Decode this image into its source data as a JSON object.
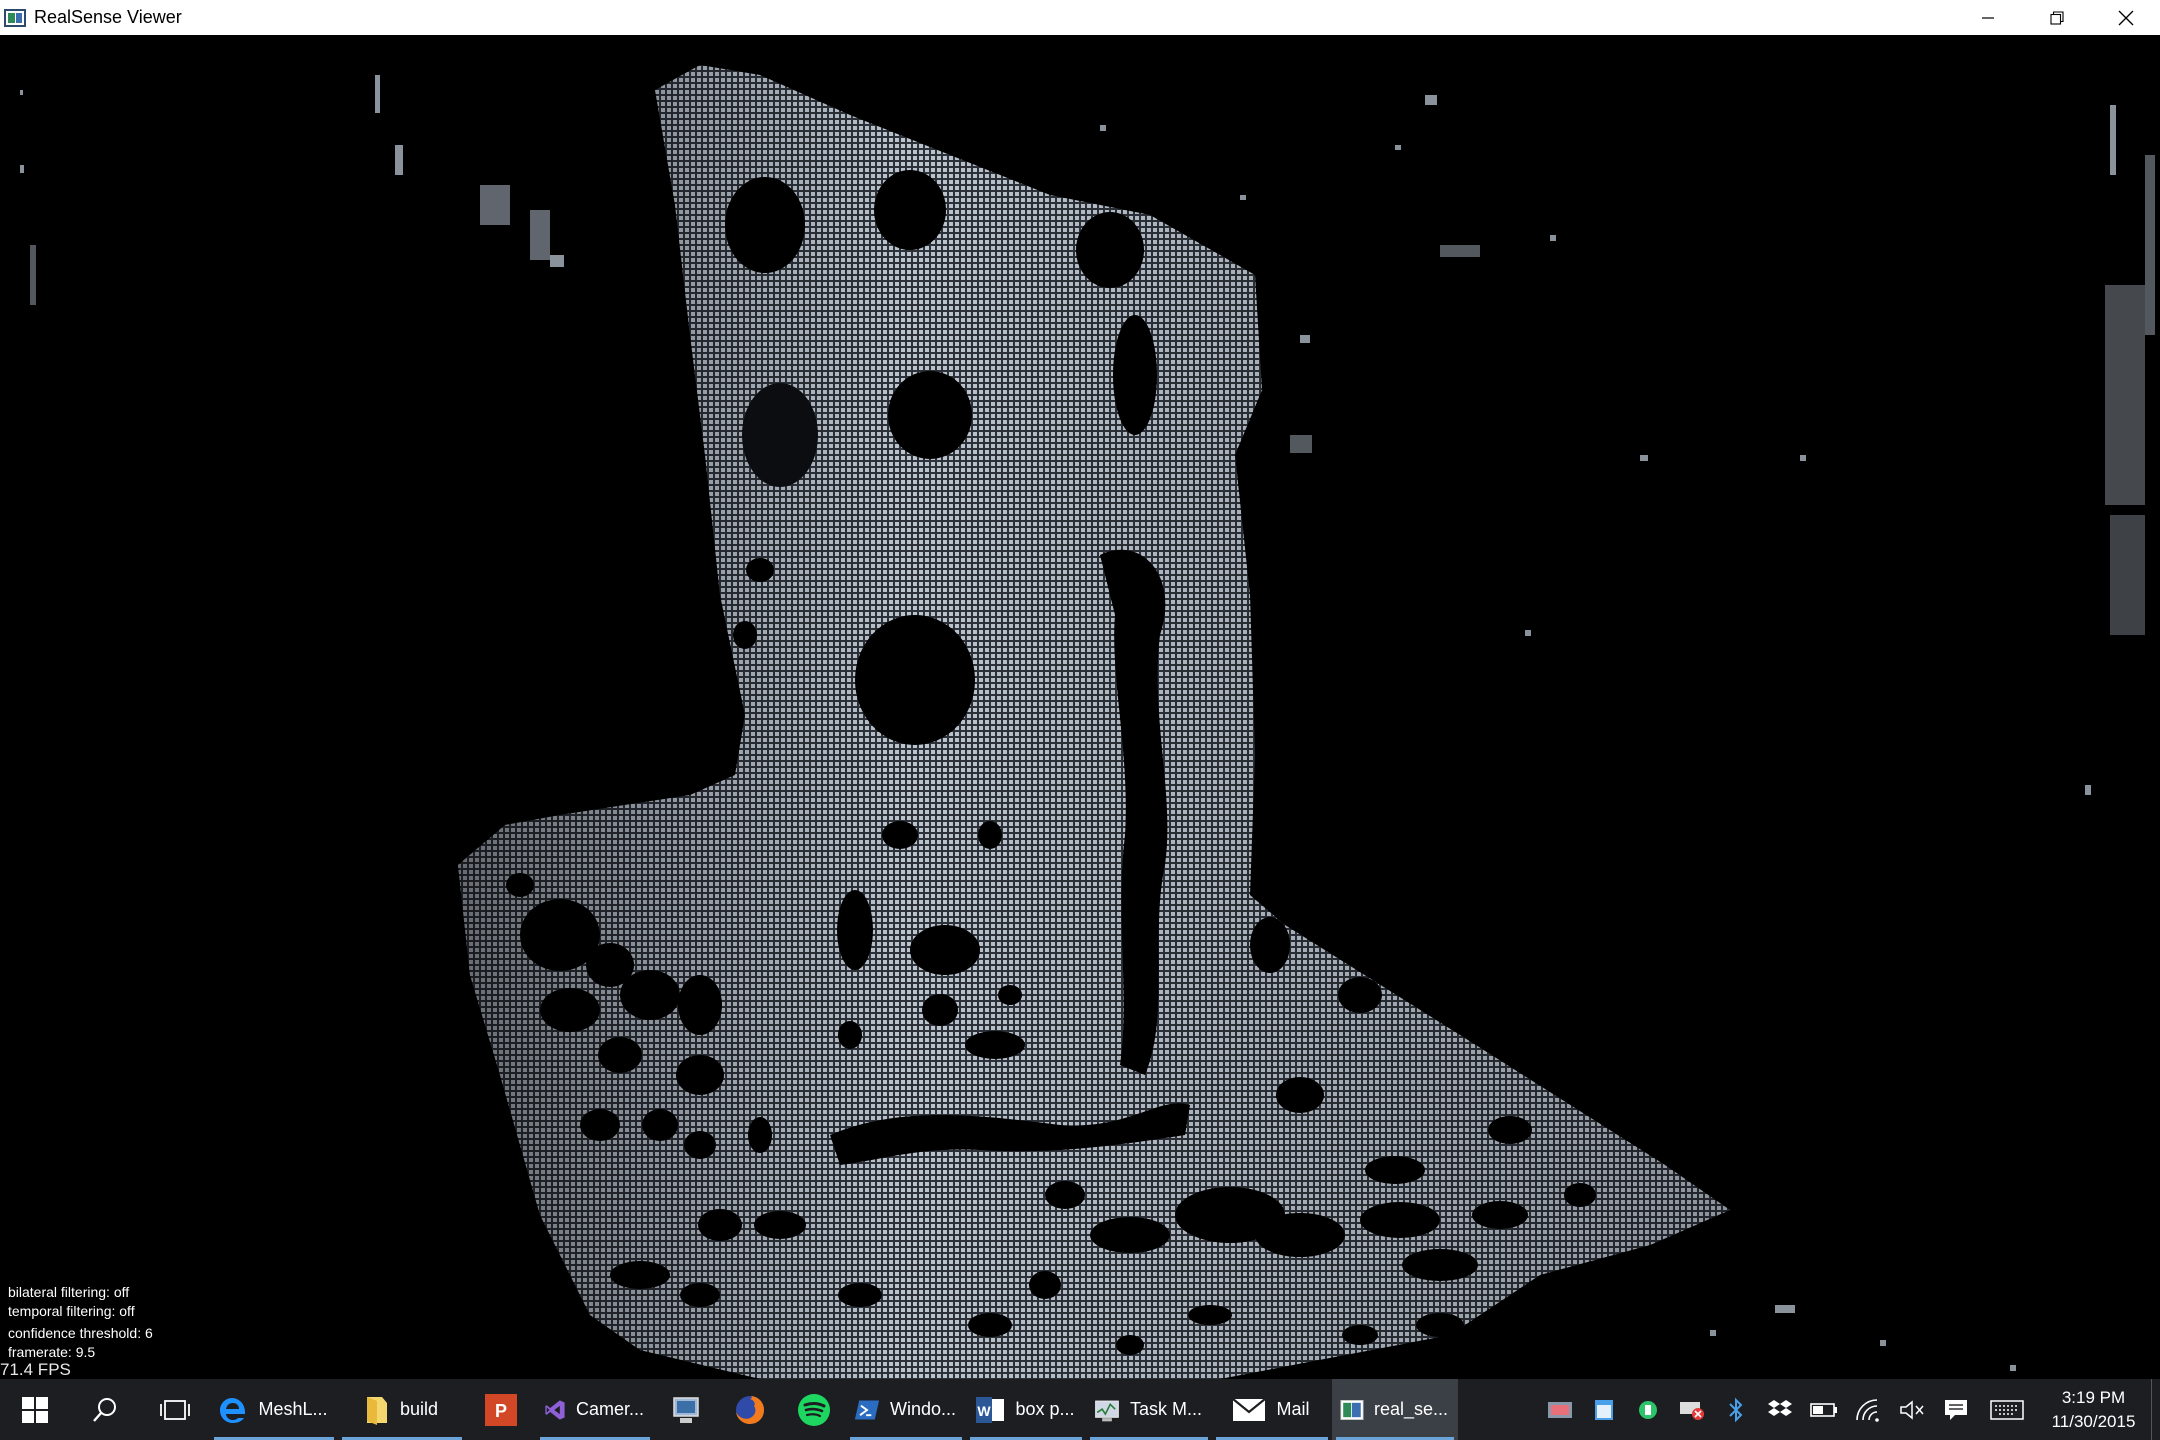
{
  "window": {
    "title": "RealSense Viewer",
    "controls": [
      "minimize",
      "restore",
      "close"
    ]
  },
  "overlay": {
    "bilateral": "bilateral filtering: off",
    "temporal": "temporal filtering: off",
    "confidence": "confidence threshold: 6",
    "framerate": "framerate: 9.5",
    "fps": "71.4 FPS"
  },
  "taskbar": {
    "apps": [
      {
        "label": "MeshL...",
        "icon": "edge-icon",
        "open": true
      },
      {
        "label": "build",
        "icon": "folder-icon",
        "open": true
      },
      {
        "label": "",
        "icon": "powerpoint-icon",
        "open": false
      },
      {
        "label": "Camer...",
        "icon": "visual-studio-icon",
        "open": true
      },
      {
        "label": "",
        "icon": "computer-management-icon",
        "open": false
      },
      {
        "label": "",
        "icon": "firefox-icon",
        "open": false
      },
      {
        "label": "",
        "icon": "spotify-icon",
        "open": false
      },
      {
        "label": "Windo...",
        "icon": "powershell-icon",
        "open": true
      },
      {
        "label": "box p...",
        "icon": "word-icon",
        "open": true
      },
      {
        "label": "Task M...",
        "icon": "task-manager-icon",
        "open": true
      },
      {
        "label": "Mail",
        "icon": "mail-icon",
        "open": true
      },
      {
        "label": "real_se...",
        "icon": "realsense-icon",
        "open": true
      }
    ],
    "clock": {
      "time": "3:19 PM",
      "date": "11/30/2015"
    }
  },
  "colors": {
    "accent": "#6aa4d8",
    "taskbar": "#1c1e22",
    "cloud": "#b4bcc6"
  }
}
